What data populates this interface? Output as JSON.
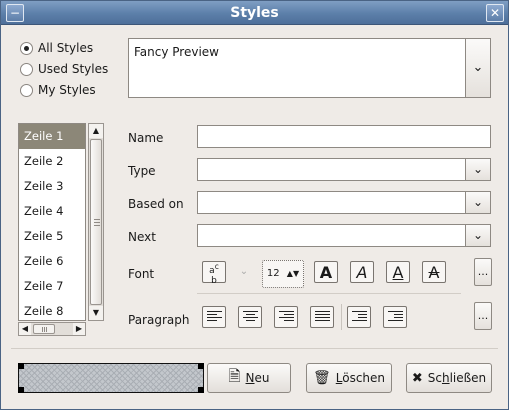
{
  "window": {
    "title": "Styles"
  },
  "filter": {
    "options": [
      {
        "label": "All Styles",
        "selected": true
      },
      {
        "label": "Used Styles",
        "selected": false
      },
      {
        "label": "My Styles",
        "selected": false
      }
    ]
  },
  "preview": {
    "text": "Fancy Preview"
  },
  "styles_list": {
    "items": [
      "Zeile 1",
      "Zeile 2",
      "Zeile 3",
      "Zeile 4",
      "Zeile 5",
      "Zeile 6",
      "Zeile 7",
      "Zeile 8"
    ],
    "selected_index": 0
  },
  "form": {
    "name_label": "Name",
    "name_value": "",
    "type_label": "Type",
    "type_value": "",
    "based_on_label": "Based on",
    "based_on_value": "",
    "next_label": "Next",
    "next_value": "",
    "font_label": "Font",
    "font_size": "12",
    "paragraph_label": "Paragraph",
    "more_label": "..."
  },
  "font_tools": {
    "case_icon": "text-case-icon",
    "bold_glyph": "A",
    "italic_glyph": "A",
    "underline_glyph": "A",
    "strike_glyph": "A"
  },
  "paragraph_tools": [
    "align-left-icon",
    "align-center-icon",
    "align-right-icon",
    "align-justify-icon",
    "indent-increase-icon",
    "indent-decrease-icon"
  ],
  "buttons": {
    "new_label_underlined": "N",
    "new_label_rest": "eu",
    "delete_label_underlined": "L",
    "delete_label_rest": "öschen",
    "close_label_pre": "Sc",
    "close_label_underlined": "h",
    "close_label_rest": "ließen"
  },
  "colors": {
    "titlebar": "#5c7fa9",
    "selection": "#8c8778"
  }
}
